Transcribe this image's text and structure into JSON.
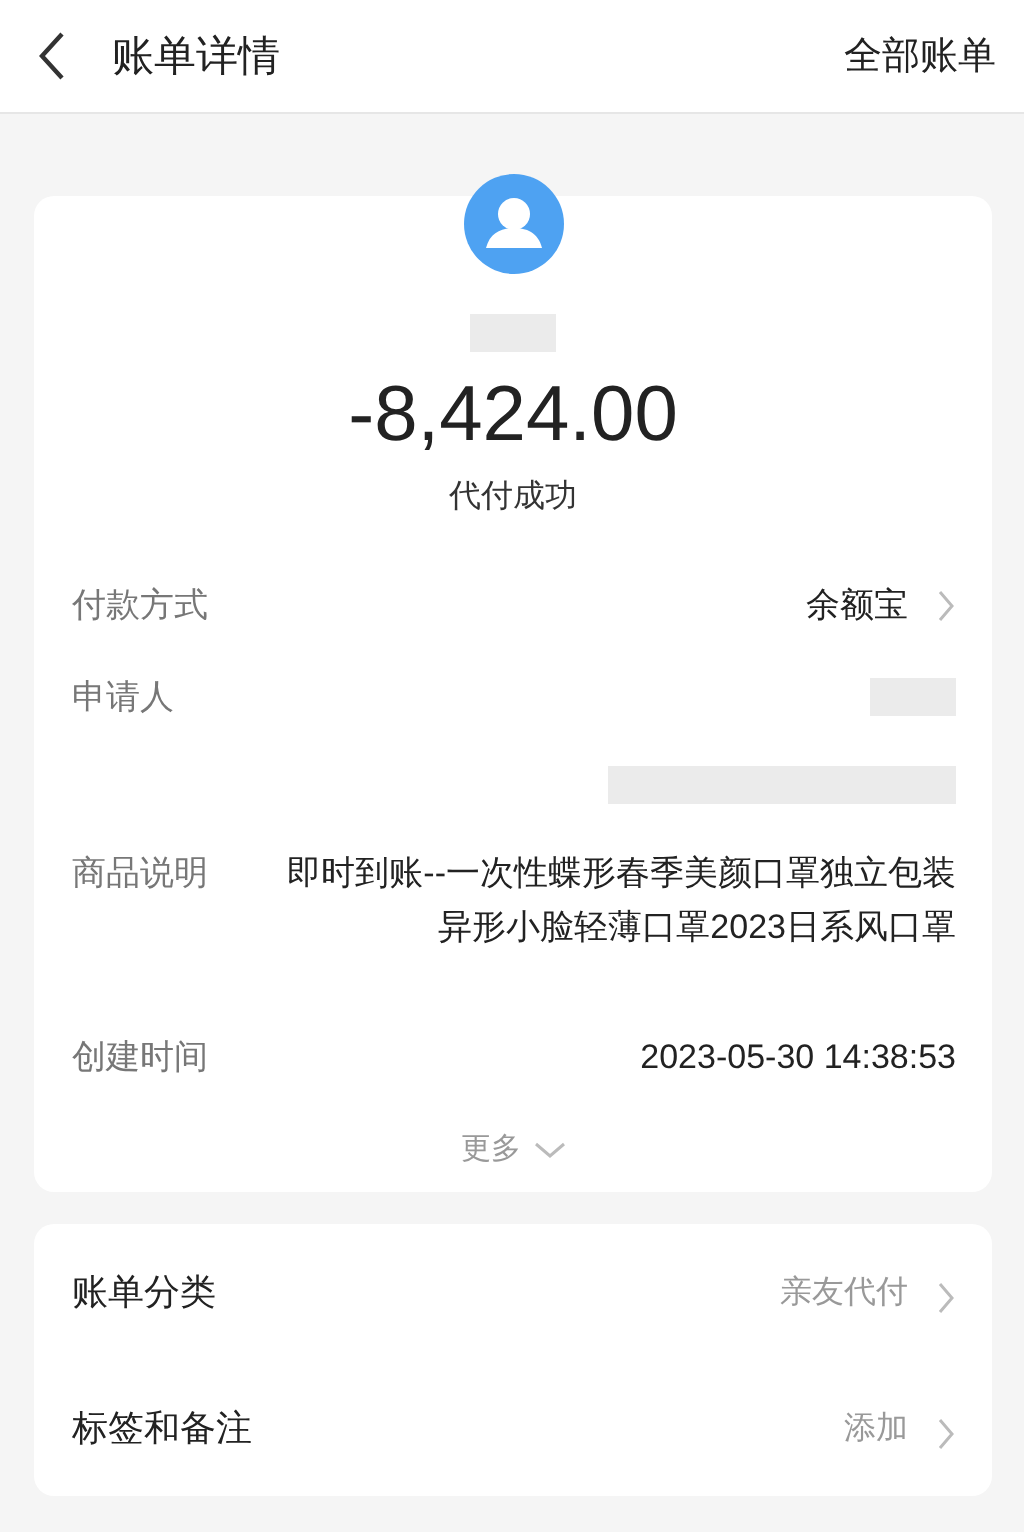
{
  "header": {
    "title": "账单详情",
    "action": "全部账单"
  },
  "summary": {
    "amount": "-8,424.00",
    "status": "代付成功"
  },
  "details": [
    {
      "kind": "text",
      "label": "付款方式",
      "value": "余额宝",
      "arrow": true
    },
    {
      "kind": "redacted",
      "label": "申请人"
    },
    {
      "kind": "redacted"
    },
    {
      "kind": "text",
      "label": "商品说明",
      "value": "即时到账--一次性蝶形春季美颜口罩独立包装异形小脸轻薄口罩2023日系风口罩",
      "arrow": false
    },
    {
      "kind": "text",
      "label": "创建时间",
      "value": "2023-05-30 14:38:53",
      "arrow": false
    }
  ],
  "more": "更多",
  "settings": [
    {
      "label": "账单分类",
      "value": "亲友代付"
    },
    {
      "label": "标签和备注",
      "value": "添加"
    }
  ]
}
